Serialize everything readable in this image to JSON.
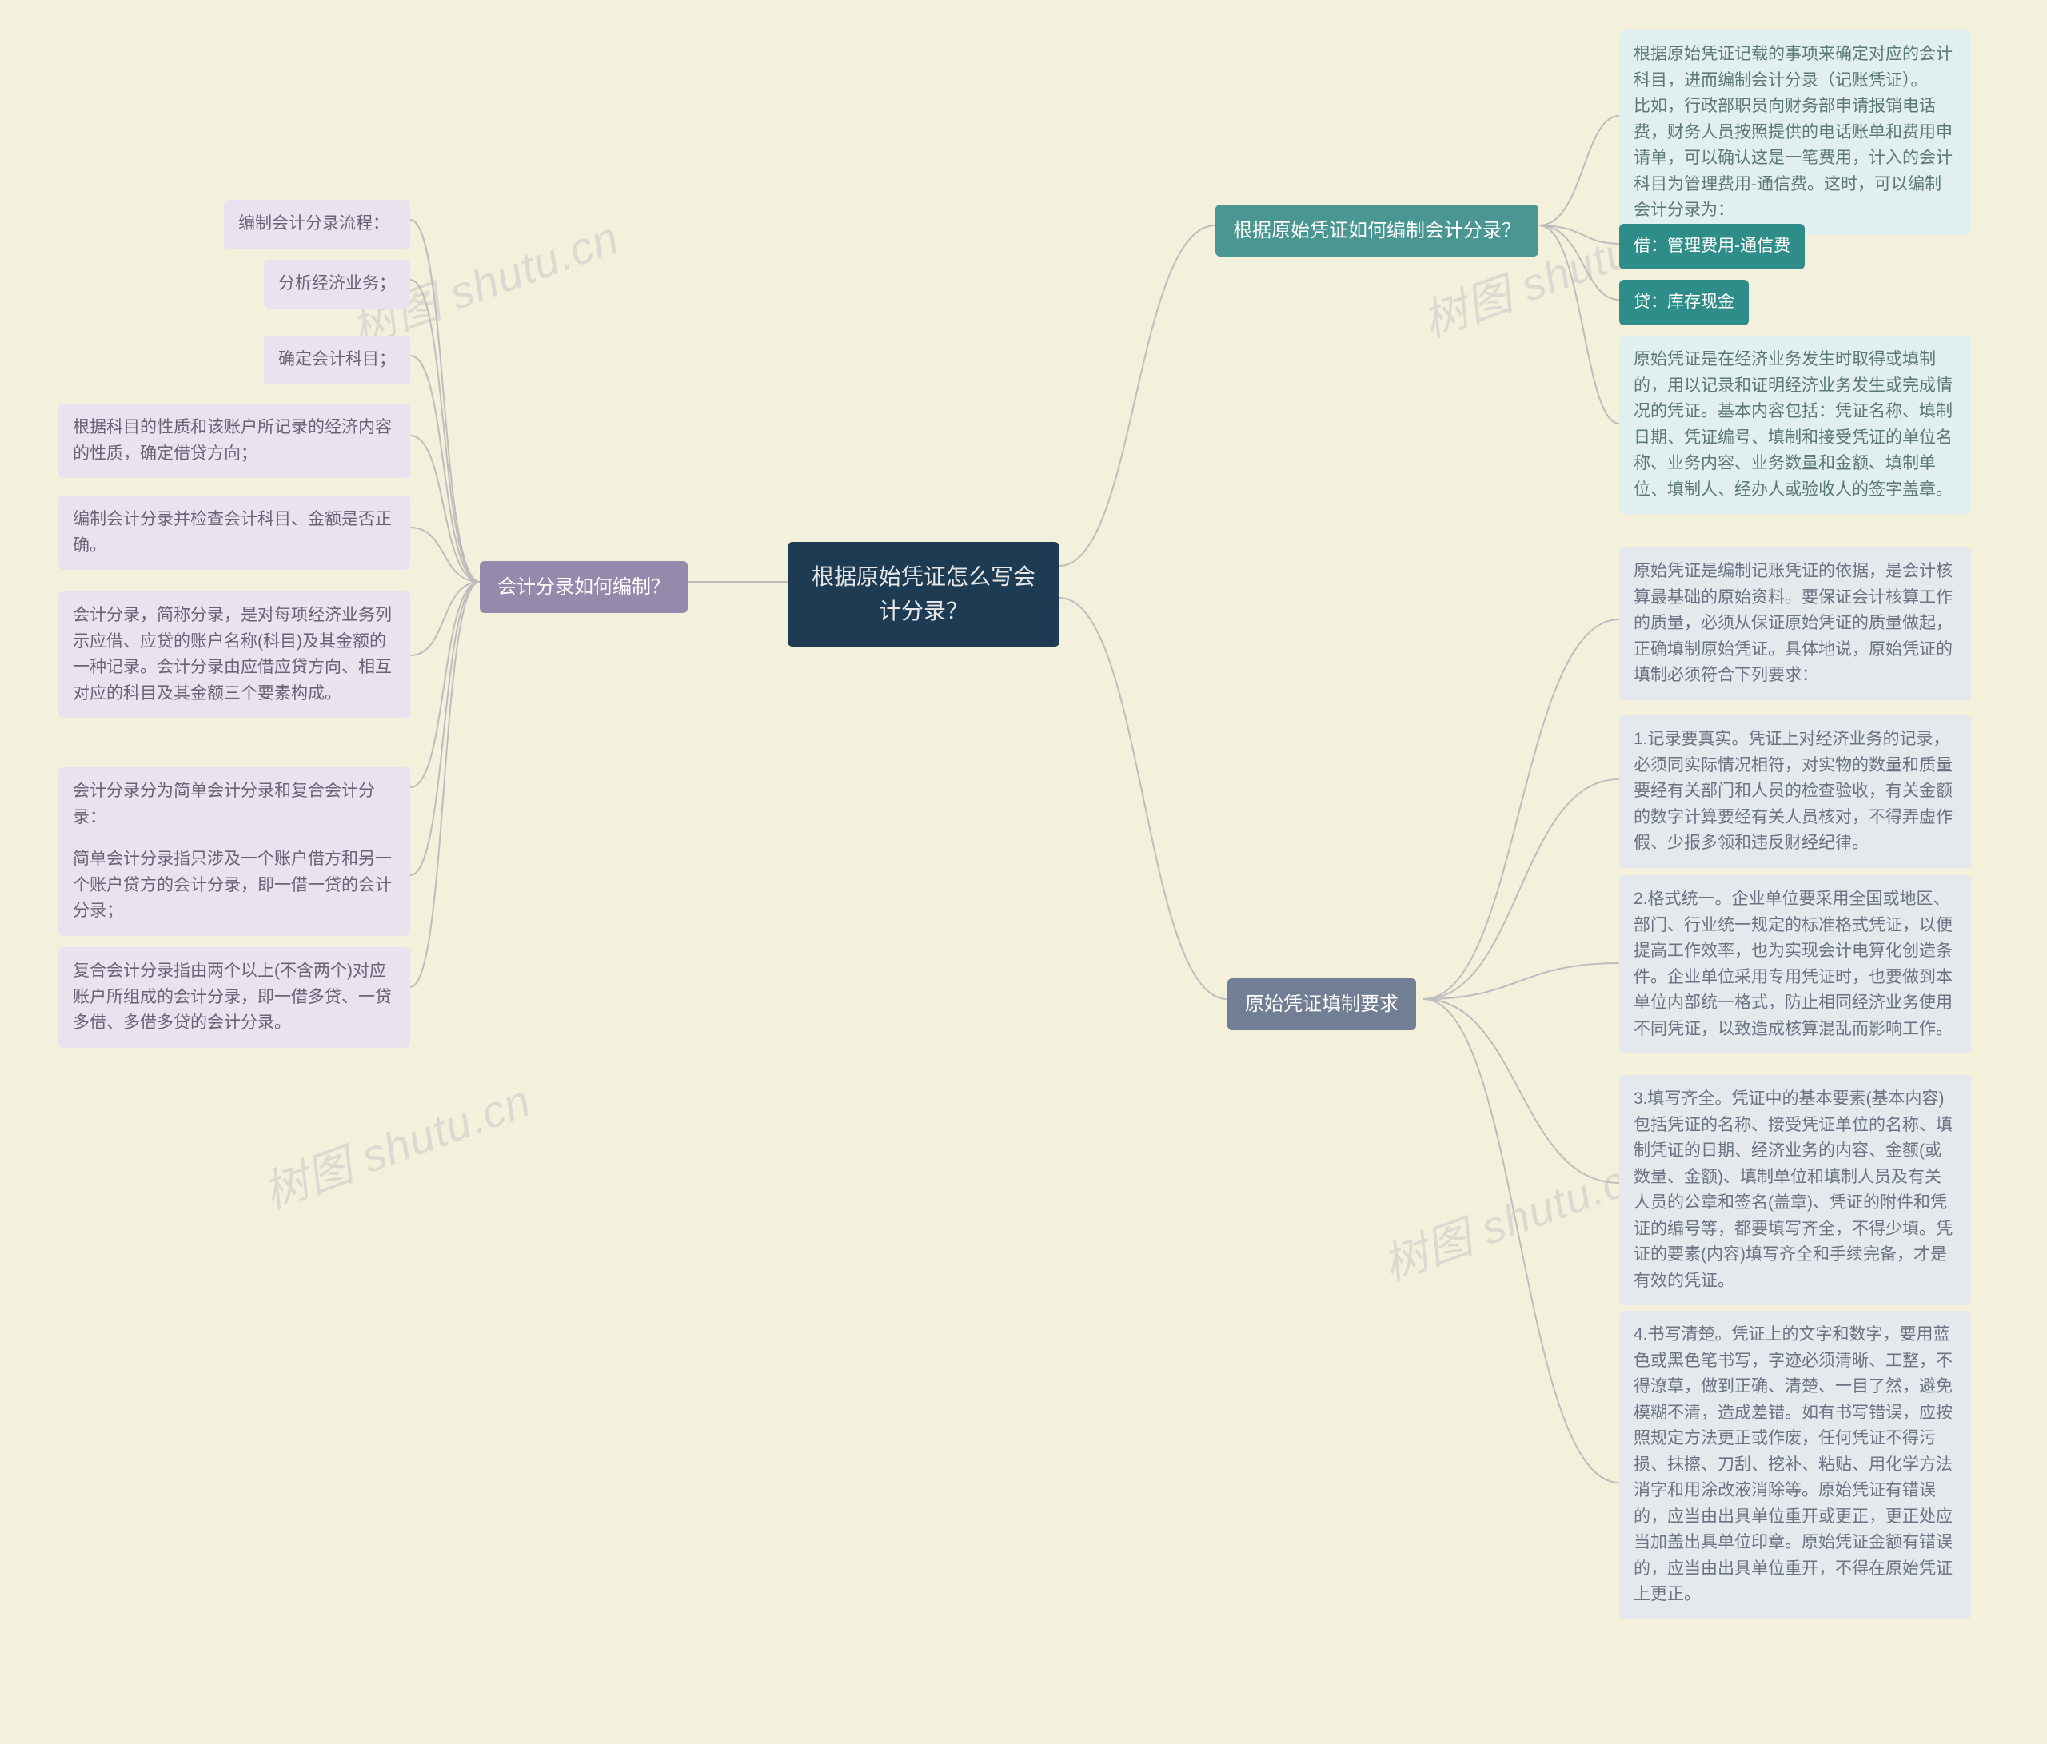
{
  "root": "根据原始凭证怎么写会计分录？",
  "left": {
    "branch": "会计分录如何编制？",
    "items": [
      "编制会计分录流程：",
      "分析经济业务；",
      "确定会计科目；",
      "根据科目的性质和该账户所记录的经济内容的性质，确定借贷方向；",
      "编制会计分录并检查会计科目、金额是否正确。",
      "会计分录，简称分录，是对每项经济业务列示应借、应贷的账户名称(科目)及其金额的一种记录。会计分录由应借应贷方向、相互对应的科目及其金额三个要素构成。",
      "会计分录分为简单会计分录和复合会计分录：",
      "简单会计分录指只涉及一个账户借方和另一个账户贷方的会计分录，即一借一贷的会计分录；",
      "复合会计分录指由两个以上(不含两个)对应账户所组成的会计分录，即一借多贷、一贷多借、多借多贷的会计分录。"
    ]
  },
  "right_top": {
    "branch": "根据原始凭证如何编制会计分录？",
    "items": [
      "根据原始凭证记载的事项来确定对应的会计科目，进而编制会计分录（记账凭证）。\n比如，行政部职员向财务部申请报销电话费，财务人员按照提供的电话账单和费用申请单，可以确认这是一笔费用，计入的会计科目为管理费用-通信费。这时，可以编制会计分录为：",
      "借：管理费用-通信费",
      "贷：库存现金",
      "原始凭证是在经济业务发生时取得或填制的，用以记录和证明经济业务发生或完成情况的凭证。基本内容包括：凭证名称、填制日期、凭证编号、填制和接受凭证的单位名称、业务内容、业务数量和金额、填制单位、填制人、经办人或验收人的签字盖章。"
    ]
  },
  "right_bottom": {
    "branch": "原始凭证填制要求",
    "items": [
      "原始凭证是编制记账凭证的依据，是会计核算最基础的原始资料。要保证会计核算工作的质量，必须从保证原始凭证的质量做起，正确填制原始凭证。具体地说，原始凭证的填制必须符合下列要求：",
      "1.记录要真实。凭证上对经济业务的记录，必须同实际情况相符，对实物的数量和质量要经有关部门和人员的检查验收，有关金额的数字计算要经有关人员核对，不得弄虚作假、少报多领和违反财经纪律。",
      "2.格式统一。企业单位要采用全国或地区、部门、行业统一规定的标准格式凭证，以便提高工作效率，也为实现会计电算化创造条件。企业单位采用专用凭证时，也要做到本单位内部统一格式，防止相同经济业务使用不同凭证，以致造成核算混乱而影响工作。",
      "3.填写齐全。凭证中的基本要素(基本内容)包括凭证的名称、接受凭证单位的名称、填制凭证的日期、经济业务的内容、金额(或数量、金额)、填制单位和填制人员及有关人员的公章和签名(盖章)、凭证的附件和凭证的编号等，都要填写齐全，不得少填。凭证的要素(内容)填写齐全和手续完备，才是有效的凭证。",
      "4.书写清楚。凭证上的文字和数字，要用蓝色或黑色笔书写，字迹必须清晰、工整，不得潦草，做到正确、清楚、一目了然，避免模糊不清，造成差错。如有书写错误，应按照规定方法更正或作废，任何凭证不得污损、抹擦、刀刮、挖补、粘贴、用化学方法消字和用涂改液消除等。原始凭证有错误的，应当由出具单位重开或更正，更正处应当加盖出具单位印章。原始凭证金额有错误的，应当由出具单位重开，不得在原始凭证上更正。"
    ]
  },
  "watermark_text": "树图 shutu.cn"
}
